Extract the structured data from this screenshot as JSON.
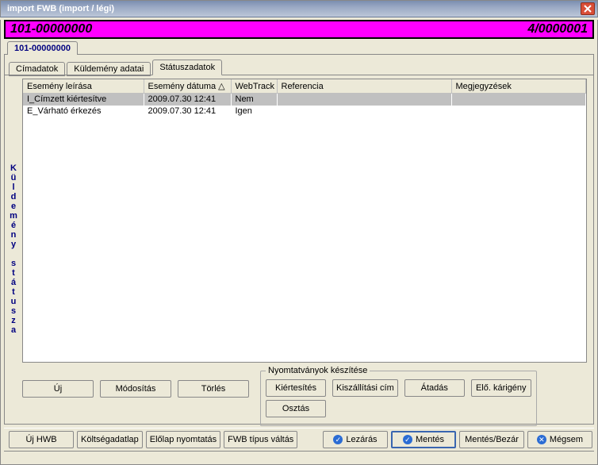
{
  "window": {
    "title": "import FWB (import / légi)"
  },
  "banner": {
    "left": "101-00000000",
    "right": "4/0000001"
  },
  "upper_tab": {
    "label": "101-00000000"
  },
  "tabs": [
    {
      "label": "Címadatok",
      "active": false
    },
    {
      "label": "Küldemény adatai",
      "active": false
    },
    {
      "label": "Státuszadatok",
      "active": true
    }
  ],
  "vertical_label": "Küldemény státusza",
  "grid": {
    "columns": [
      "Esemény leírása",
      "Esemény dátuma △",
      "WebTrack",
      "Referencia",
      "Megjegyzések"
    ],
    "rows": [
      {
        "cells": [
          "I_Címzett kiértesítve",
          "2009.07.30 12:41",
          "Nem",
          "",
          ""
        ],
        "selected": true
      },
      {
        "cells": [
          "E_Várható érkezés",
          "2009.07.30 12:41",
          "Igen",
          "",
          ""
        ],
        "selected": false
      }
    ]
  },
  "action_buttons": {
    "new": "Új",
    "modify": "Módosítás",
    "delete": "Törlés"
  },
  "print_group": {
    "legend": "Nyomtatványok készítése",
    "b1": "Kiértesítés",
    "b2": "Kiszállítási cím",
    "b3": "Átadás",
    "b4": "Elő. kárigény",
    "b5": "Osztás"
  },
  "bottom": {
    "uj_hwb": "Új HWB",
    "koltseg": "Költségadatlap",
    "elolap": "Előlap nyomtatás",
    "tipus": "FWB típus váltás",
    "lezaras": "Lezárás",
    "mentes": "Mentés",
    "mentes_bezar": "Mentés/Bezár",
    "megsem": "Mégsem"
  }
}
